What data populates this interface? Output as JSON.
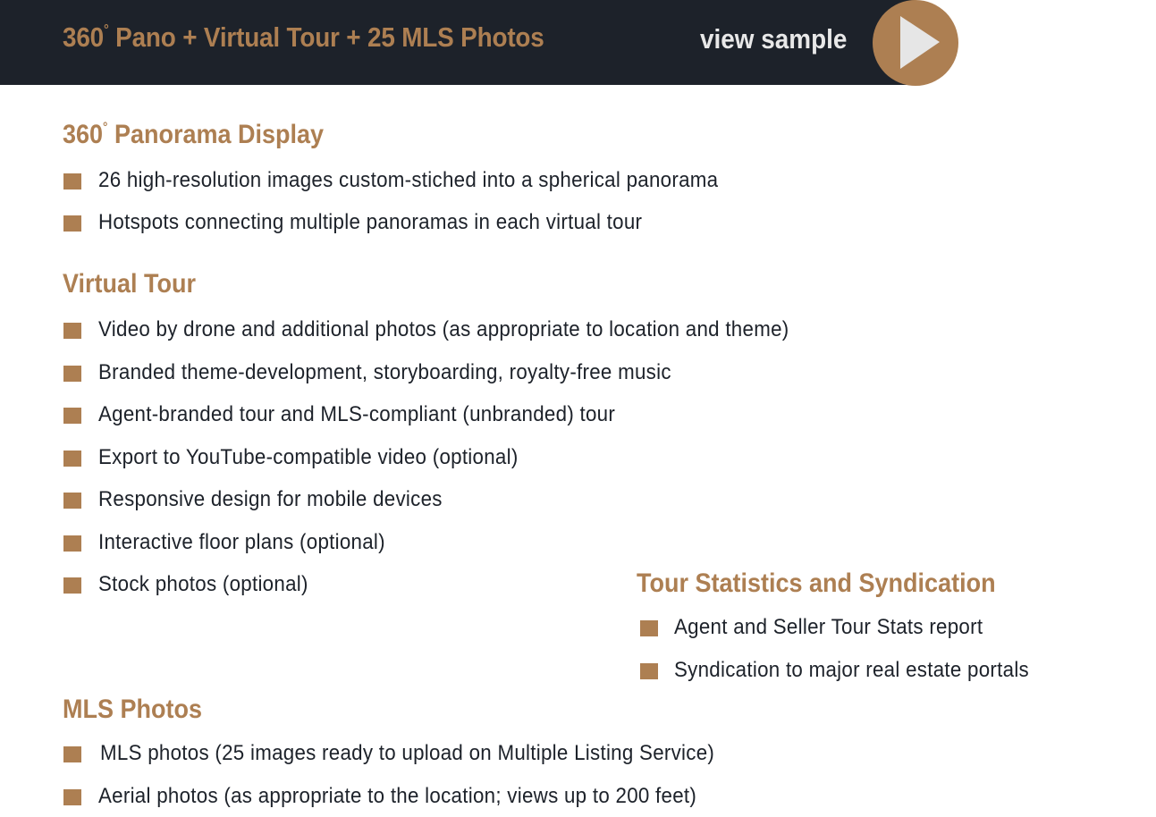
{
  "header": {
    "title_prefix": "360",
    "title_degree": "°",
    "title_rest": " Pano + Virtual Tour + 25 MLS Photos",
    "view_sample_label": "view sample",
    "play_icon": "play-icon"
  },
  "colors": {
    "accent": "#ad7f52",
    "header_bg": "#1d222a",
    "text": "#1d222a",
    "header_text": "#e8e8e8"
  },
  "sections": {
    "panorama": {
      "title_prefix": "360",
      "title_degree": "°",
      "title_rest": " Panorama Display",
      "items": [
        "26 high-resolution images custom-stiched into a spherical panorama",
        "Hotspots connecting multiple panoramas in each virtual tour"
      ]
    },
    "virtual_tour": {
      "title": "Virtual Tour",
      "items": [
        "Video by drone and additional photos (as appropriate to location and theme)",
        "Branded theme-development, storyboarding, royalty-free music",
        "Agent-branded tour and MLS-compliant (unbranded) tour",
        "Export to YouTube-compatible video (optional)",
        "Responsive design for mobile devices",
        "Interactive floor plans (optional)",
        "Stock photos (optional)"
      ]
    },
    "stats": {
      "title": "Tour Statistics and Syndication",
      "items": [
        "Agent and Seller Tour Stats report",
        "Syndication to major real estate portals"
      ]
    },
    "mls": {
      "title": "MLS Photos",
      "items": [
        "MLS photos (25 images ready to upload on Multiple Listing Service)",
        "Aerial photos (as appropriate to the location; views up to 200 feet)"
      ]
    }
  }
}
